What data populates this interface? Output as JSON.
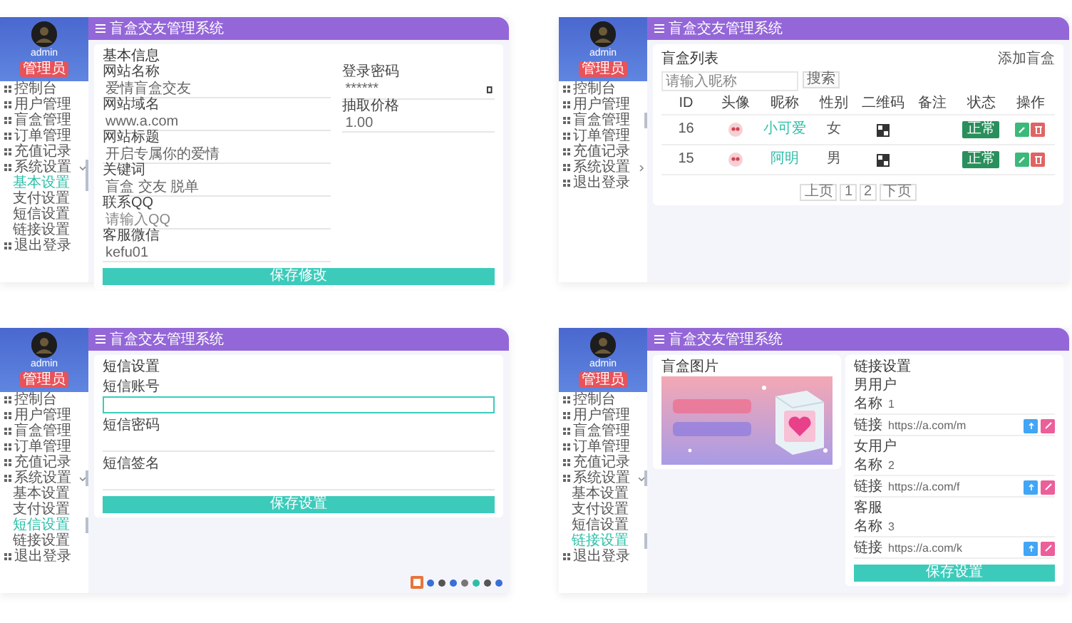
{
  "panels": [
    {
      "kind": "form",
      "sidebar": {
        "user": "admin",
        "badge": "管理员",
        "items": [
          {
            "label": "控制台",
            "selected": false
          },
          {
            "label": "用户管理",
            "selected": false
          },
          {
            "label": "盲盒管理",
            "selected": false
          },
          {
            "label": "订单管理",
            "selected": false
          },
          {
            "label": "充值记录",
            "selected": false
          },
          {
            "label": "系统设置",
            "selected": true,
            "expanded": true,
            "children": [
              {
                "label": "基本设置",
                "selected": true
              },
              {
                "label": "支付设置",
                "selected": false
              },
              {
                "label": "短信设置",
                "selected": false
              },
              {
                "label": "链接设置",
                "selected": false
              }
            ]
          },
          {
            "label": "退出登录",
            "selected": false
          }
        ]
      },
      "header": {
        "title": "盲盒交友管理系统"
      },
      "card": {
        "title": "基本信息",
        "left": [
          {
            "label": "网站名称",
            "value": "爱情盲盒交友"
          },
          {
            "label": "网站域名",
            "value": "www.a.com"
          },
          {
            "label": "网站标题",
            "value": "开启专属你的爱情"
          },
          {
            "label": "关键词",
            "value": "盲盒 交友 脱单"
          },
          {
            "label": "联系QQ",
            "placeholder": "请输入QQ"
          },
          {
            "label": "客服微信",
            "value": "kefu01"
          }
        ],
        "right": [
          {
            "label": "登录密码",
            "value": "******",
            "kind": "password"
          },
          {
            "label": "抽取价格",
            "value": "1.00",
            "kind": "text"
          }
        ],
        "button": "保存修改"
      }
    },
    {
      "kind": "table",
      "sidebar": {
        "user": "admin",
        "badge": "管理员",
        "items": [
          {
            "label": "控制台",
            "selected": false
          },
          {
            "label": "用户管理",
            "selected": false
          },
          {
            "label": "盲盒管理",
            "selected": true
          },
          {
            "label": "订单管理",
            "selected": false
          },
          {
            "label": "充值记录",
            "selected": false
          },
          {
            "label": "系统设置",
            "selected": false,
            "expanded": false
          },
          {
            "label": "退出登录",
            "selected": false
          }
        ]
      },
      "header": {
        "title": "盲盒交友管理系统"
      },
      "card": {
        "title": "盲盒列表",
        "action": "添加盲盒",
        "search": {
          "placeholder": "请输入昵称",
          "button": "搜索"
        },
        "columns": [
          "ID",
          "头像",
          "昵称",
          "性别",
          "二维码",
          "备注",
          "状态",
          "操作"
        ],
        "rows": [
          {
            "id": "16",
            "nickname": "小可爱",
            "gender": "女",
            "remark": "",
            "status": "正常"
          },
          {
            "id": "15",
            "nickname": "阿明",
            "gender": "男",
            "remark": "",
            "status": "正常"
          }
        ],
        "pages": [
          "上页",
          "1",
          "2",
          "下页"
        ]
      }
    },
    {
      "kind": "settings",
      "sidebar": {
        "user": "admin",
        "badge": "管理员",
        "items": [
          {
            "label": "控制台",
            "selected": false
          },
          {
            "label": "用户管理",
            "selected": false
          },
          {
            "label": "盲盒管理",
            "selected": false
          },
          {
            "label": "订单管理",
            "selected": false
          },
          {
            "label": "充值记录",
            "selected": false
          },
          {
            "label": "系统设置",
            "selected": true,
            "expanded": true,
            "children": [
              {
                "label": "基本设置",
                "selected": false
              },
              {
                "label": "支付设置",
                "selected": false
              },
              {
                "label": "短信设置",
                "selected": true
              },
              {
                "label": "链接设置",
                "selected": false
              }
            ]
          },
          {
            "label": "退出登录",
            "selected": false
          }
        ]
      },
      "header": {
        "title": "盲盒交友管理系统"
      },
      "card": {
        "title": "短信设置",
        "fields": [
          {
            "label": "短信账号",
            "focused": true
          },
          {
            "label": "短信密码",
            "focused": false
          },
          {
            "label": "短信签名",
            "focused": false
          }
        ],
        "button": "保存设置"
      }
    },
    {
      "kind": "links",
      "sidebar": {
        "user": "admin",
        "badge": "管理员",
        "items": [
          {
            "label": "控制台",
            "selected": false
          },
          {
            "label": "用户管理",
            "selected": false
          },
          {
            "label": "盲盒管理",
            "selected": false
          },
          {
            "label": "订单管理",
            "selected": false
          },
          {
            "label": "充值记录",
            "selected": false
          },
          {
            "label": "系统设置",
            "selected": true,
            "expanded": true,
            "children": [
              {
                "label": "基本设置",
                "selected": false
              },
              {
                "label": "支付设置",
                "selected": false
              },
              {
                "label": "短信设置",
                "selected": false
              },
              {
                "label": "链接设置",
                "selected": true
              }
            ]
          },
          {
            "label": "退出登录",
            "selected": false
          }
        ]
      },
      "header": {
        "title": "盲盒交友管理系统"
      },
      "card": {
        "banner_title": "盲盒图片",
        "title": "链接设置",
        "groups": [
          {
            "label": "男用户",
            "name_label": "名称",
            "name": "1",
            "url_label": "链接",
            "url": "https://a.com/m"
          },
          {
            "label": "女用户",
            "name_label": "名称",
            "name": "2",
            "url_label": "链接",
            "url": "https://a.com/f"
          },
          {
            "label": "客服",
            "name_label": "名称",
            "name": "3",
            "url_label": "链接",
            "url": "https://a.com/k"
          }
        ],
        "button": "保存设置"
      }
    }
  ]
}
